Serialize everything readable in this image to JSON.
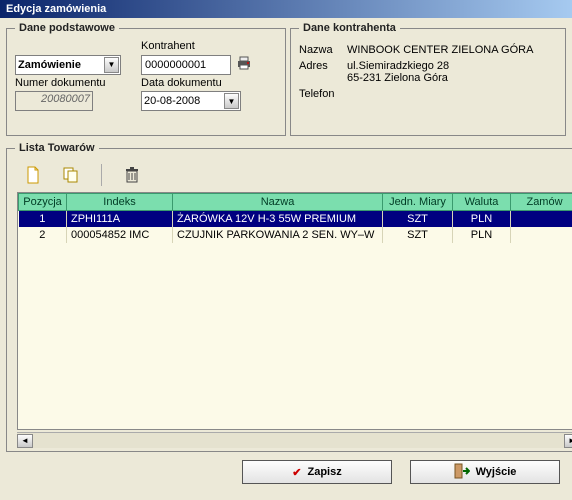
{
  "window": {
    "title": "Edycja zamówienia"
  },
  "basic": {
    "legend": "Dane podstawowe",
    "type_label": "",
    "type_value": "Zamówienie",
    "kontrahent_label": "Kontrahent",
    "kontrahent_value": "0000000001",
    "doc_number_label": "Numer dokumentu",
    "doc_number_value": "20080007",
    "doc_date_label": "Data dokumentu",
    "doc_date_value": "20-08-2008"
  },
  "kontr": {
    "legend": "Dane kontrahenta",
    "name_label": "Nazwa",
    "name_value": "WINBOOK CENTER ZIELONA GÓRA",
    "addr_label": "Adres",
    "addr_line1": "ul.Siemiradzkiego 28",
    "addr_line2": "65-231 Zielona Góra",
    "phone_label": "Telefon",
    "phone_value": ""
  },
  "list": {
    "legend": "Lista Towarów",
    "columns": {
      "pozycja": "Pozycja",
      "indeks": "Indeks",
      "nazwa": "Nazwa",
      "jm": "Jedn. Miary",
      "waluta": "Waluta",
      "zamow": "Zamów"
    },
    "rows": [
      {
        "pozycja": "1",
        "indeks": "ZPHI111A",
        "nazwa": "ŻARÓWKA 12V H-3 55W PREMIUM",
        "jm": "SZT",
        "waluta": "PLN",
        "zamow": ""
      },
      {
        "pozycja": "2",
        "indeks": "000054852 IMC",
        "nazwa": "CZUJNIK PARKOWANIA 2 SEN. WY–W",
        "jm": "SZT",
        "waluta": "PLN",
        "zamow": ""
      }
    ]
  },
  "buttons": {
    "save": "Zapisz",
    "exit": "Wyjście"
  },
  "icons": {
    "printer": "printer-icon",
    "new": "new-doc-icon",
    "copy": "copy-doc-icon",
    "delete": "trash-icon",
    "check": "check-icon",
    "exit": "exit-door-icon"
  }
}
